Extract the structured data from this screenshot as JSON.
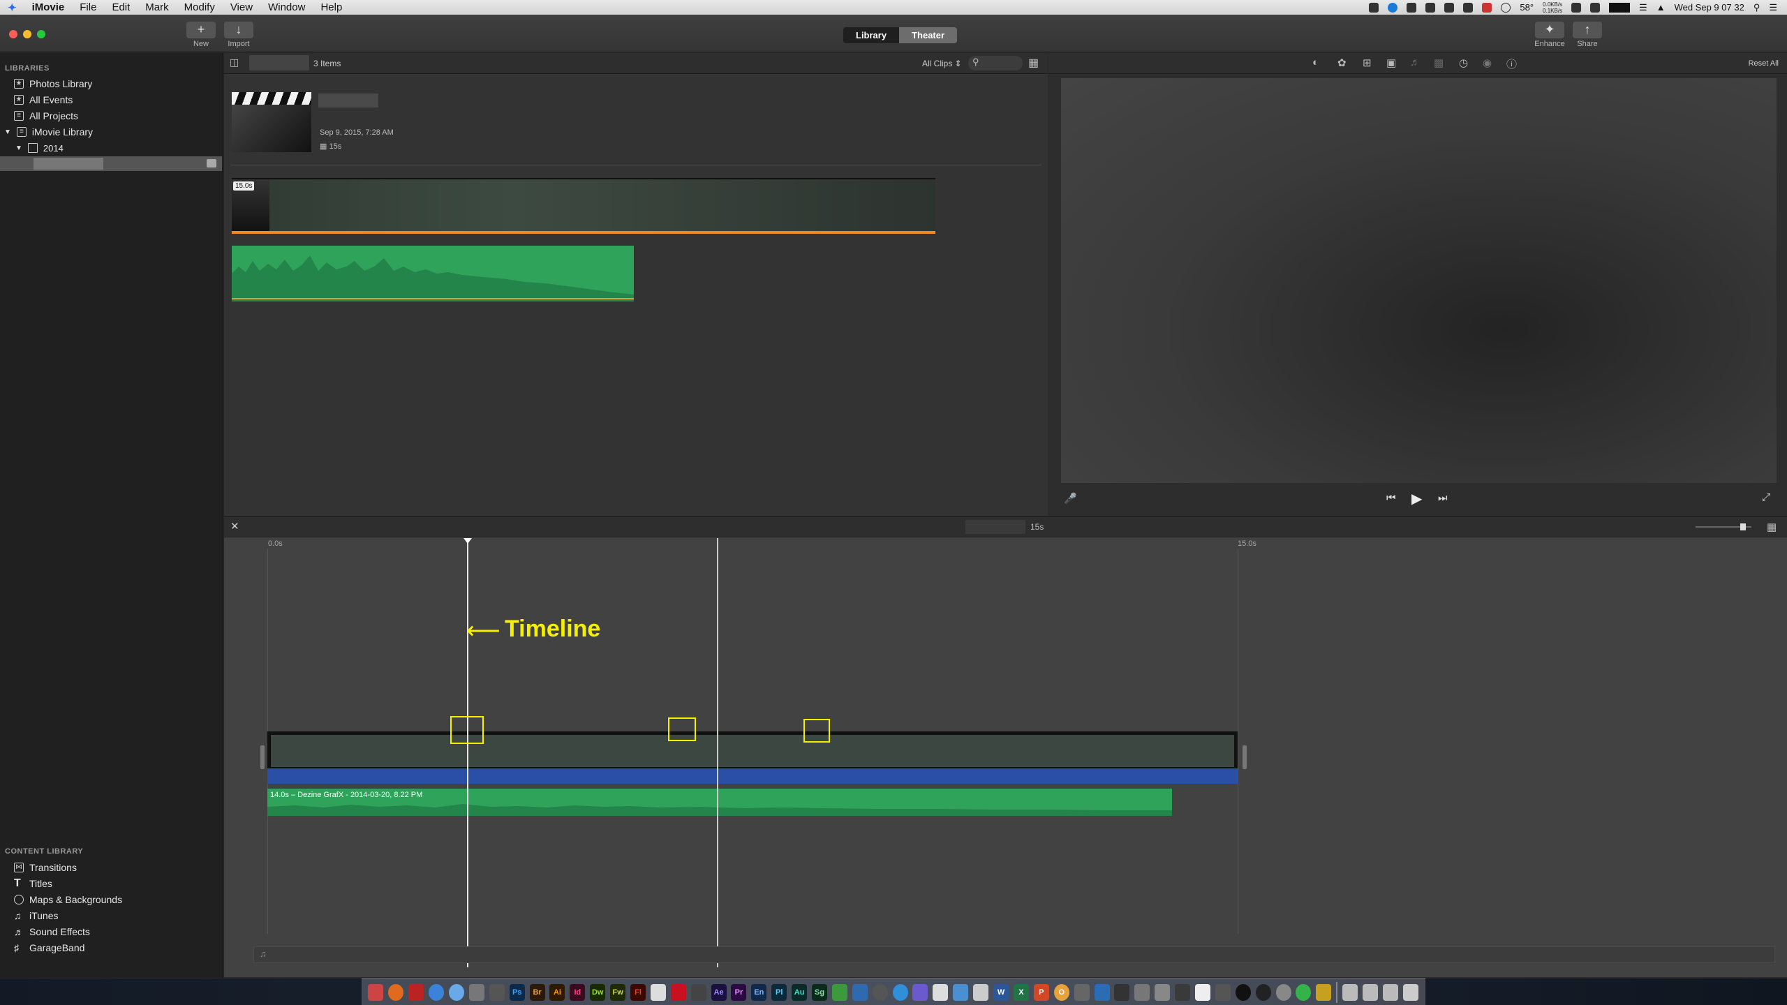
{
  "menubar": {
    "apple": "",
    "app_name": "iMovie",
    "menus": [
      "File",
      "Edit",
      "Mark",
      "Modify",
      "View",
      "Window",
      "Help"
    ],
    "status": {
      "temperature": "58°",
      "net_up": "0.0KB/s",
      "net_down": "0.1KB/s",
      "datetime": "Wed Sep 9  07 32"
    }
  },
  "toolbar": {
    "new_label": "New",
    "import_label": "Import",
    "library_tab": "Library",
    "theater_tab": "Theater",
    "enhance_label": "Enhance",
    "share_label": "Share"
  },
  "sidebar": {
    "libraries_header": "LIBRARIES",
    "items": [
      {
        "label": "Photos Library",
        "icon": "photos-library-icon"
      },
      {
        "label": "All Events",
        "icon": "star-icon"
      },
      {
        "label": "All Projects",
        "icon": "grid-icon"
      },
      {
        "label": "iMovie Library",
        "icon": "grid-icon"
      },
      {
        "label": "2014",
        "icon": "folder-icon"
      }
    ],
    "content_header": "CONTENT LIBRARY",
    "content_items": [
      {
        "label": "Transitions",
        "icon": "transitions-icon"
      },
      {
        "label": "Titles",
        "icon": "titles-icon"
      },
      {
        "label": "Maps & Backgrounds",
        "icon": "globe-icon"
      },
      {
        "label": "iTunes",
        "icon": "music-note-icon"
      },
      {
        "label": "Sound Effects",
        "icon": "speaker-icon"
      },
      {
        "label": "GarageBand",
        "icon": "guitar-icon"
      }
    ]
  },
  "browser": {
    "item_count": "3 Items",
    "filter": "All Clips",
    "event": {
      "date": "Sep 9, 2015, 7:28 AM",
      "duration": "15s"
    },
    "clip_duration": "15.0s"
  },
  "viewer": {
    "reset_all": "Reset All"
  },
  "timeline": {
    "duration": "15s",
    "start_label": "0.0s",
    "end_label": "15.0s",
    "annotation": "Timeline",
    "audio_clip_label": "14.0s – Dezine GrafX - 2014-03-20, 8.22 PM"
  },
  "colors": {
    "accent_yellow": "#f5f000",
    "audio_green": "#2fa35a",
    "title_blue": "#2a4fa6",
    "selection_orange": "#f08a1e"
  },
  "dock": {
    "apps": [
      "Ps",
      "Br",
      "Ai",
      "Id",
      "Dw",
      "Fw",
      "Fl",
      "Ae",
      "Pr",
      "En",
      "Pl",
      "Au",
      "Sg",
      "W",
      "X",
      "P",
      "O"
    ]
  }
}
